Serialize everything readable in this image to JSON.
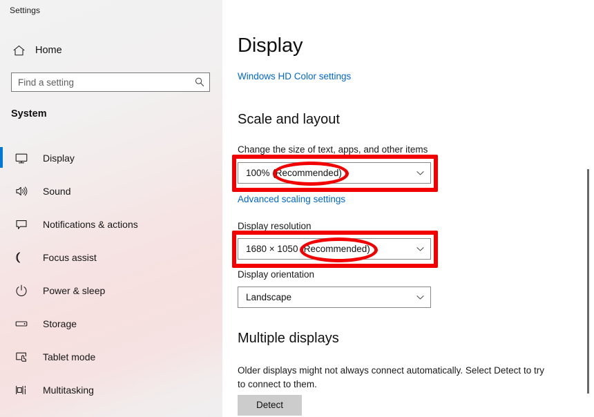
{
  "window": {
    "title": "Settings",
    "controls": {
      "minimize": "minimize-icon",
      "maximize": "maximize-icon",
      "close": "close-icon"
    }
  },
  "sidebar": {
    "home_label": "Home",
    "home_icon": "home-icon",
    "search": {
      "placeholder": "Find a setting",
      "value": "",
      "icon": "search-icon"
    },
    "section_label": "System",
    "items": [
      {
        "label": "Display",
        "icon": "monitor-icon",
        "selected": true
      },
      {
        "label": "Sound",
        "icon": "speaker-icon",
        "selected": false
      },
      {
        "label": "Notifications & actions",
        "icon": "notification-icon",
        "selected": false
      },
      {
        "label": "Focus assist",
        "icon": "moon-icon",
        "selected": false
      },
      {
        "label": "Power & sleep",
        "icon": "power-icon",
        "selected": false
      },
      {
        "label": "Storage",
        "icon": "storage-icon",
        "selected": false
      },
      {
        "label": "Tablet mode",
        "icon": "tablet-icon",
        "selected": false
      },
      {
        "label": "Multitasking",
        "icon": "multitasking-icon",
        "selected": false
      }
    ]
  },
  "main": {
    "page_title": "Display",
    "hd_color_link": "Windows HD Color settings",
    "scale_heading": "Scale and layout",
    "scale_label": "Change the size of text, apps, and other items",
    "scale_value": "100% (Recommended)",
    "advanced_scaling_link": "Advanced scaling settings",
    "resolution_label": "Display resolution",
    "resolution_value": "1680 × 1050 (Recommended)",
    "orientation_label": "Display orientation",
    "orientation_value": "Landscape",
    "multiple_displays_heading": "Multiple displays",
    "multiple_displays_desc": "Older displays might not always connect automatically. Select Detect to try to connect to them.",
    "detect_button": "Detect"
  },
  "annotations": {
    "color": "#f20000",
    "scale_rect": "highlight around scale dropdown",
    "scale_ellipse": "circle around (Recommended)",
    "resolution_rect": "highlight around resolution dropdown",
    "resolution_ellipse": "circle around (Recommended)"
  },
  "theme": {
    "accent": "#0078d7",
    "link": "#0066cc",
    "annotation_red": "#f20000",
    "button_bg": "#cccccc"
  }
}
